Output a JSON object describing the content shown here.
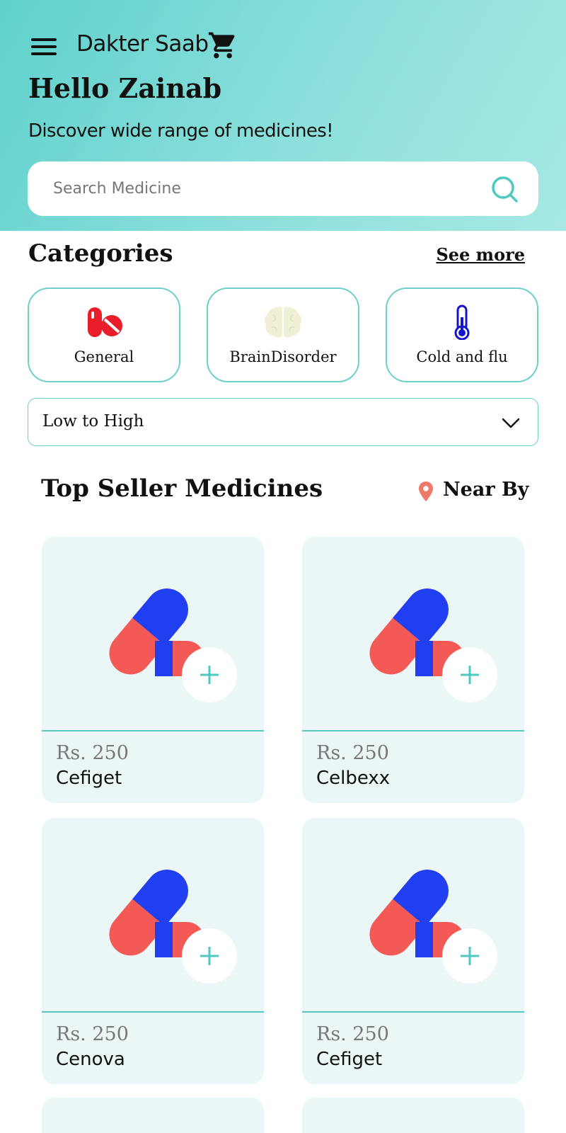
{
  "app": {
    "title": "Dakter Saab"
  },
  "header": {
    "greeting": "Hello Zainab",
    "subtitle": "Discover wide range of medicines!"
  },
  "search": {
    "placeholder": "Search Medicine",
    "value": ""
  },
  "categories": {
    "title": "Categories",
    "see_more": "See more",
    "items": [
      {
        "label": "General",
        "icon": "pills-icon"
      },
      {
        "label": "BrainDisorder",
        "icon": "brain-icon"
      },
      {
        "label": "Cold and flu",
        "icon": "thermometer-icon"
      }
    ]
  },
  "sort": {
    "selected": "Low to High"
  },
  "top_sellers": {
    "title": "Top Seller Medicines",
    "nearby_label": "Near By",
    "products": [
      {
        "price": "Rs. 250",
        "name": "Cefiget"
      },
      {
        "price": "Rs. 250",
        "name": "Celbexx"
      },
      {
        "price": "Rs. 250",
        "name": "Cenova"
      },
      {
        "price": "Rs. 250",
        "name": "Cefiget"
      }
    ]
  },
  "colors": {
    "accent": "#5fd1cc",
    "card_bg": "#ebf7f7",
    "pill_blue": "#1f3ff0",
    "pill_red": "#f35a55",
    "pin": "#f07a6a"
  }
}
